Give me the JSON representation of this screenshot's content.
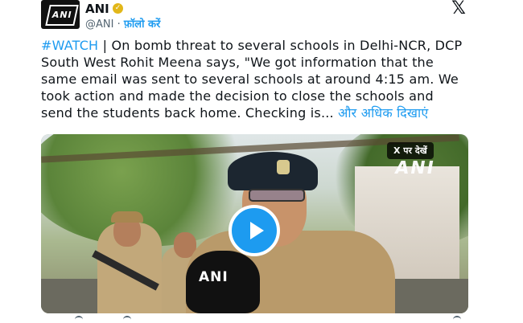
{
  "header": {
    "author_name": "ANI",
    "handle": "@ANI",
    "separator": " · ",
    "follow_label": "फ़ॉलो करें",
    "avatar_text": "ANI",
    "brand_icon": "x-logo-icon",
    "verified_icon": "gold-check-icon"
  },
  "tweet": {
    "hashtag": "#WATCH",
    "body": " | On bomb threat to several schools in Delhi-NCR, DCP South West Rohit Meena says, \"We got information that the same email was sent to several schools at around 4:15 am. We took action and made the decision to close the schools and send the students back home. Checking is... ",
    "show_more": "और अधिक दिखाएं"
  },
  "media": {
    "watch_on_x": "X पर देखें",
    "watermark": "ANI",
    "mic_label": "ANI",
    "play_icon": "play-icon"
  },
  "colors": {
    "link": "#1d9bf0",
    "text": "#0f1419",
    "muted": "#536471",
    "verified": "#e2b719"
  }
}
